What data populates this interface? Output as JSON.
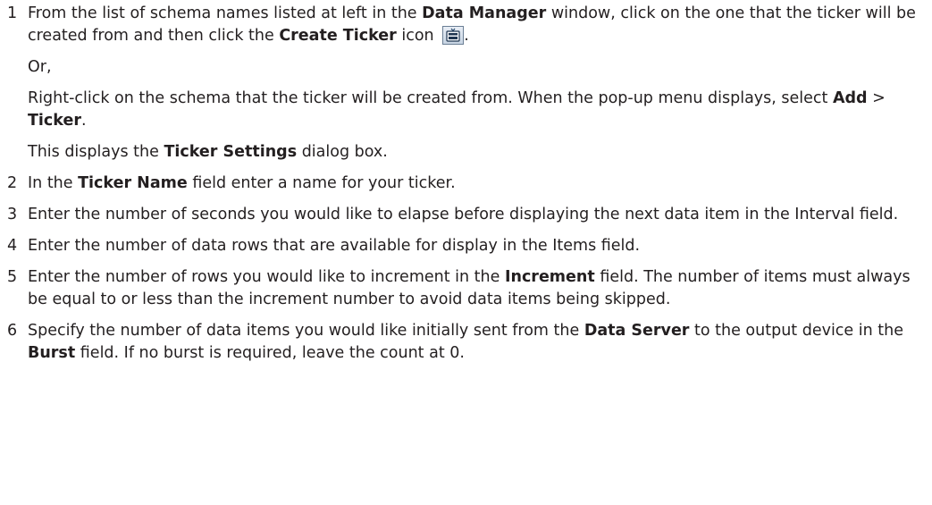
{
  "steps": [
    {
      "number": "1",
      "paragraphs": [
        [
          {
            "t": "From the list of schema names listed at left in the "
          },
          {
            "t": "Data Manager",
            "b": true
          },
          {
            "t": " window, click on the one that the ticker will be created from and then click the "
          },
          {
            "t": "Create Ticker",
            "b": true
          },
          {
            "t": " icon "
          },
          {
            "icon": "create-ticker-icon"
          },
          {
            "t": "."
          }
        ],
        [
          {
            "t": "Or,"
          }
        ],
        [
          {
            "t": "Right-click on the schema that the ticker will be created from. When the pop-up menu displays, select "
          },
          {
            "t": "Add",
            "b": true
          },
          {
            "t": " > "
          },
          {
            "t": "Ticker",
            "b": true
          },
          {
            "t": "."
          }
        ],
        [
          {
            "t": "This displays the "
          },
          {
            "t": "Ticker Settings",
            "b": true
          },
          {
            "t": " dialog box."
          }
        ]
      ]
    },
    {
      "number": "2",
      "paragraphs": [
        [
          {
            "t": "In the "
          },
          {
            "t": "Ticker Name",
            "b": true
          },
          {
            "t": " field enter a name for your ticker."
          }
        ]
      ]
    },
    {
      "number": "3",
      "paragraphs": [
        [
          {
            "t": "Enter the number of seconds you would like to elapse before displaying the next data item in the Interval field."
          }
        ]
      ]
    },
    {
      "number": "4",
      "paragraphs": [
        [
          {
            "t": "Enter the number of data rows that are available for display in the Items field."
          }
        ]
      ]
    },
    {
      "number": "5",
      "paragraphs": [
        [
          {
            "t": "Enter the number of rows you would like to increment in the "
          },
          {
            "t": "Increment",
            "b": true
          },
          {
            "t": " field. The number of items must always be equal to or less than the increment number to avoid data items being skipped."
          }
        ]
      ]
    },
    {
      "number": "6",
      "paragraphs": [
        [
          {
            "t": "Specify the number of data items you would like initially sent from the "
          },
          {
            "t": "Data Server",
            "b": true
          },
          {
            "t": " to the output device in the "
          },
          {
            "t": "Burst",
            "b": true
          },
          {
            "t": " field. If no burst is required, leave the count at 0."
          }
        ]
      ]
    }
  ]
}
